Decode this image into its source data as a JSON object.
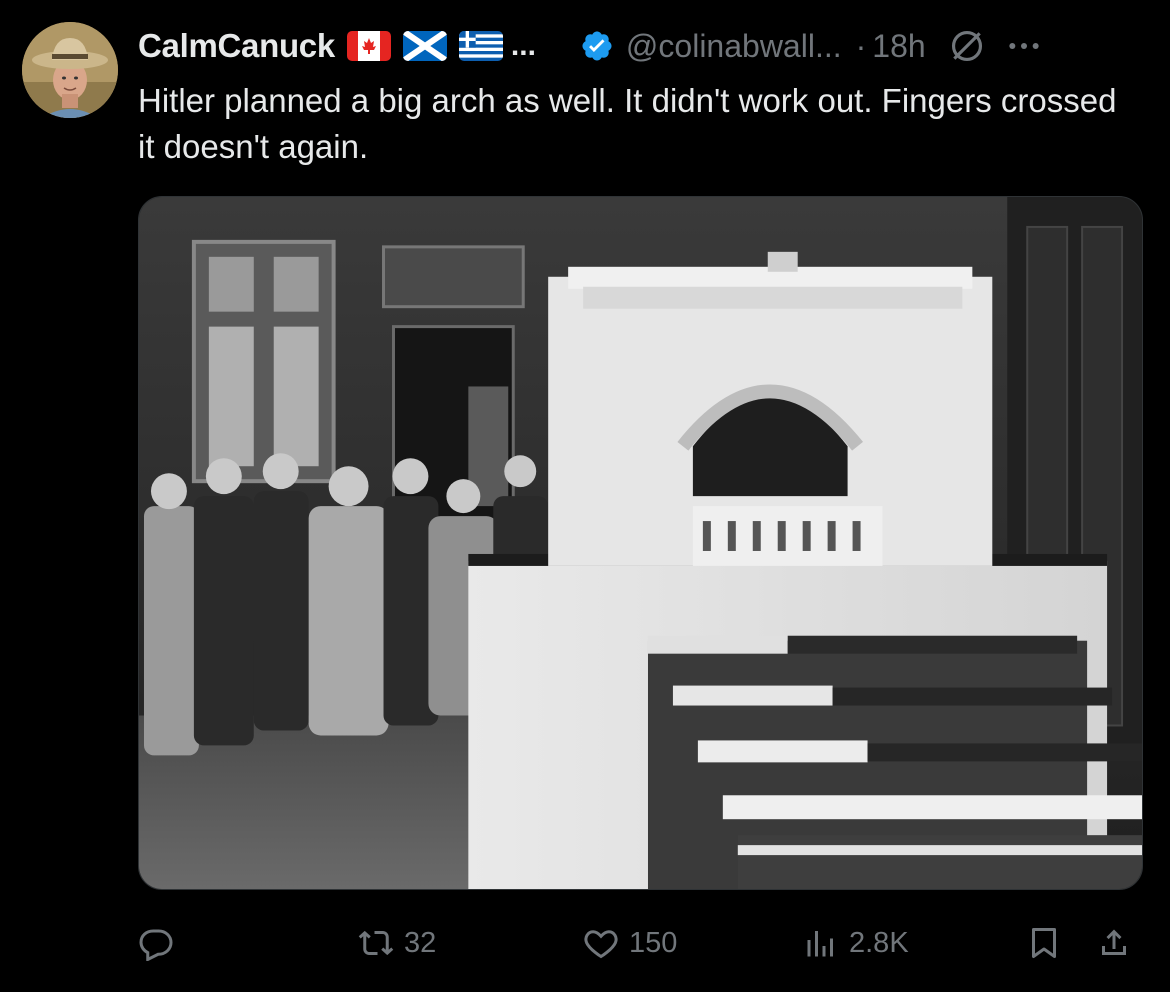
{
  "author": {
    "display_name": "CalmCanuck",
    "flags": [
      "canada-flag",
      "scotland-flag",
      "greece-flag"
    ],
    "name_overflow": "...",
    "verified_icon": "verified-badge-icon",
    "handle": "@colinabwall...",
    "separator": "·",
    "time": "18h"
  },
  "tweet": {
    "text": "Hitler planned a big arch as well. It didn't work out. Fingers crossed it doesn't again."
  },
  "media": {
    "kind": "black-and-white photograph",
    "subject_icon": "arch-model-photo"
  },
  "actions": {
    "reply": {
      "icon": "reply-icon",
      "count": ""
    },
    "retweet": {
      "icon": "retweet-icon",
      "count": "32"
    },
    "like": {
      "icon": "heart-icon",
      "count": "150"
    },
    "views": {
      "icon": "views-chart-icon",
      "count": "2.8K"
    },
    "bookmark": {
      "icon": "bookmark-icon"
    },
    "share": {
      "icon": "share-icon"
    }
  },
  "colors": {
    "background": "#000000",
    "text_primary": "#e7e9ea",
    "text_secondary": "#71767b",
    "verified_blue": "#1d9bf0"
  }
}
